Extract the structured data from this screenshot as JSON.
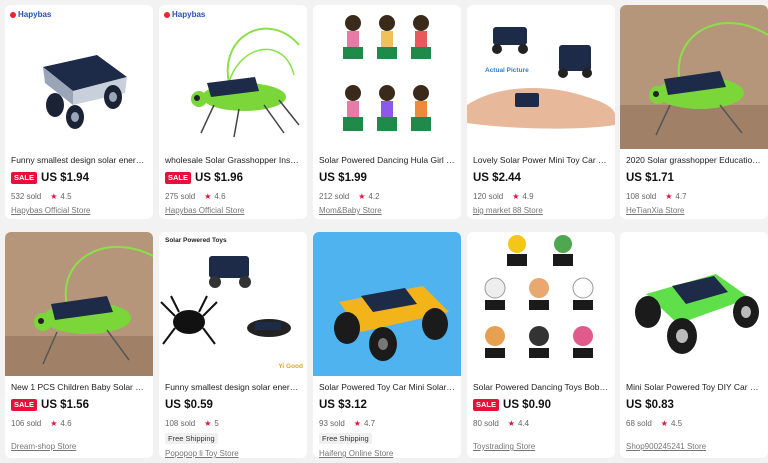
{
  "products": [
    {
      "title": "Funny smallest design solar energ...",
      "sale": "SALE",
      "price": "US $1.94",
      "sold": "532 sold",
      "rating": "4.5",
      "shipping": "",
      "store": "Hapybas Official Store",
      "image_icon": "solar-car-icon",
      "logo": "Hapybas"
    },
    {
      "title": "wholesale Solar Grasshopper Inse...",
      "sale": "SALE",
      "price": "US $1.96",
      "sold": "275 sold",
      "rating": "4.6",
      "shipping": "",
      "store": "Hapybas Official Store",
      "image_icon": "solar-grasshopper-icon",
      "logo": "Hapybas"
    },
    {
      "title": "Solar Powered Dancing Hula Girl D...",
      "sale": "",
      "price": "US $1.99",
      "sold": "212 sold",
      "rating": "4.2",
      "shipping": "",
      "store": "Mom&Baby Store",
      "image_icon": "hula-girl-icon",
      "logo": ""
    },
    {
      "title": "Lovely Solar Power Mini Toy Car R...",
      "sale": "",
      "price": "US $2.44",
      "sold": "120 sold",
      "rating": "4.9",
      "shipping": "",
      "store": "big market 88 Store",
      "image_icon": "hand-mini-car-icon",
      "logo": "",
      "caption": "Actual Picture"
    },
    {
      "title": "2020 Solar grasshopper Education...",
      "sale": "",
      "price": "US $1.71",
      "sold": "108 sold",
      "rating": "4.7",
      "shipping": "",
      "store": "HeTianXia Store",
      "image_icon": "grasshopper-photo-icon",
      "logo": ""
    },
    {
      "title": "New 1 PCS Children Baby Solar Po...",
      "sale": "SALE",
      "price": "US $1.56",
      "sold": "106 sold",
      "rating": "4.6",
      "shipping": "",
      "store": "Dream-shop Store",
      "image_icon": "grasshopper-photo-icon",
      "logo": ""
    },
    {
      "title": "Funny smallest design solar energ...",
      "sale": "",
      "price": "US $0.59",
      "sold": "108 sold",
      "rating": "5",
      "shipping": "Free Shipping",
      "store": "Popopop li Toy Store",
      "image_icon": "solar-toys-icon",
      "logo": "",
      "caption": "Solar Powered Toys",
      "caption2": "Yi Good"
    },
    {
      "title": "Solar Powered Toy Car Mini Solar ...",
      "sale": "",
      "price": "US $3.12",
      "sold": "93 sold",
      "rating": "4.7",
      "shipping": "Free Shipping",
      "store": "Haifeng Online Store",
      "image_icon": "diy-solar-car-icon",
      "logo": ""
    },
    {
      "title": "Solar Powered Dancing Toys Bobbl...",
      "sale": "SALE",
      "price": "US $0.90",
      "sold": "80 sold",
      "rating": "4.4",
      "shipping": "",
      "store": "Toystrading Store",
      "image_icon": "bobble-toys-icon",
      "logo": ""
    },
    {
      "title": "Mini Solar Powered Toy DIY Car Kit...",
      "sale": "",
      "price": "US $0.83",
      "sold": "68 sold",
      "rating": "4.5",
      "shipping": "",
      "store": "Shop900245241 Store",
      "image_icon": "green-diy-car-icon",
      "logo": ""
    }
  ],
  "colors": {
    "sale": "#e8103a",
    "star": "#e8103a",
    "background": "#f2f2f2"
  }
}
